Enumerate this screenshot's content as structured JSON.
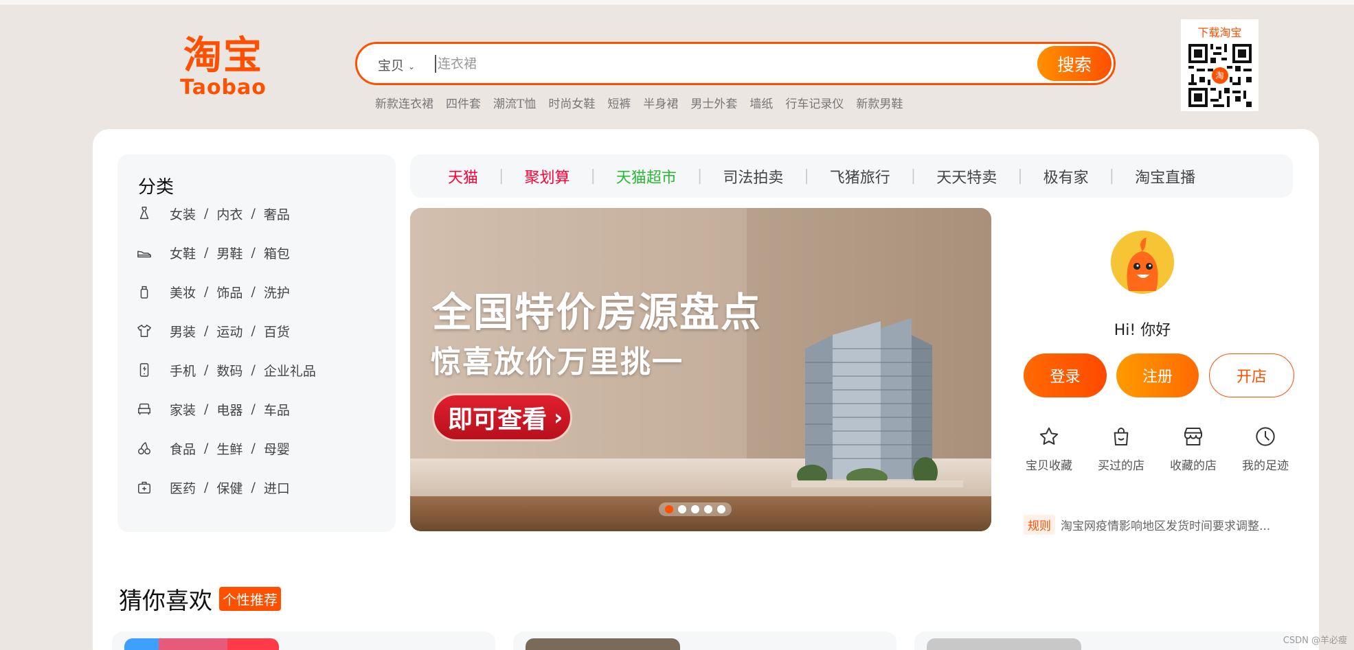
{
  "header": {
    "logo_cn": "淘宝",
    "logo_en": "Taobao",
    "search": {
      "category": "宝贝",
      "placeholder": "连衣裙",
      "button": "搜索"
    },
    "hot_words": [
      "新款连衣裙",
      "四件套",
      "潮流T恤",
      "时尚女鞋",
      "短裤",
      "半身裙",
      "男士外套",
      "墙纸",
      "行车记录仪",
      "新款男鞋"
    ],
    "download": {
      "title": "下载淘宝",
      "qr_badge": "淘"
    }
  },
  "categories": {
    "title": "分类",
    "rows": [
      {
        "icon": "dress-icon",
        "items": [
          "女装",
          "内衣",
          "奢品"
        ]
      },
      {
        "icon": "shoe-icon",
        "items": [
          "女鞋",
          "男鞋",
          "箱包"
        ]
      },
      {
        "icon": "cosmetics-icon",
        "items": [
          "美妆",
          "饰品",
          "洗护"
        ]
      },
      {
        "icon": "tshirt-icon",
        "items": [
          "男装",
          "运动",
          "百货"
        ]
      },
      {
        "icon": "phone-icon",
        "items": [
          "手机",
          "数码",
          "企业礼品"
        ]
      },
      {
        "icon": "sofa-icon",
        "items": [
          "家装",
          "电器",
          "车品"
        ]
      },
      {
        "icon": "cherry-icon",
        "items": [
          "食品",
          "生鲜",
          "母婴"
        ]
      },
      {
        "icon": "medkit-icon",
        "items": [
          "医药",
          "保健",
          "进口"
        ]
      }
    ]
  },
  "nav": [
    {
      "label": "天猫",
      "color": "#ff0036"
    },
    {
      "label": "聚划算",
      "color": "#ff0036"
    },
    {
      "label": "天猫超市",
      "color": "#2ab934"
    },
    {
      "label": "司法拍卖",
      "color": "#444444"
    },
    {
      "label": "飞猪旅行",
      "color": "#444444"
    },
    {
      "label": "天天特卖",
      "color": "#444444"
    },
    {
      "label": "极有家",
      "color": "#444444"
    },
    {
      "label": "淘宝直播",
      "color": "#444444"
    }
  ],
  "banner": {
    "headline": "全国特价房源盘点",
    "subline": "惊喜放价万里挑一",
    "cta": "即可查看",
    "slide_count": 5,
    "active_slide": 1
  },
  "user": {
    "greeting": "Hi! 你好",
    "login": "登录",
    "register": "注册",
    "open_shop": "开店",
    "quick_links": [
      {
        "icon": "star-icon",
        "label": "宝贝收藏"
      },
      {
        "icon": "bag-icon",
        "label": "买过的店"
      },
      {
        "icon": "store-icon",
        "label": "收藏的店"
      },
      {
        "icon": "clock-icon",
        "label": "我的足迹"
      }
    ],
    "notice_tag": "规则",
    "notice_text": "淘宝网疫情影响地区发货时间要求调整..."
  },
  "guess": {
    "title": "猜你喜欢",
    "tag": "个性推荐"
  },
  "watermark": "CSDN @羊必瘦",
  "colors": {
    "brand": "#ff5000",
    "tmall_red": "#ff0036",
    "supermarket_green": "#2ab934"
  }
}
